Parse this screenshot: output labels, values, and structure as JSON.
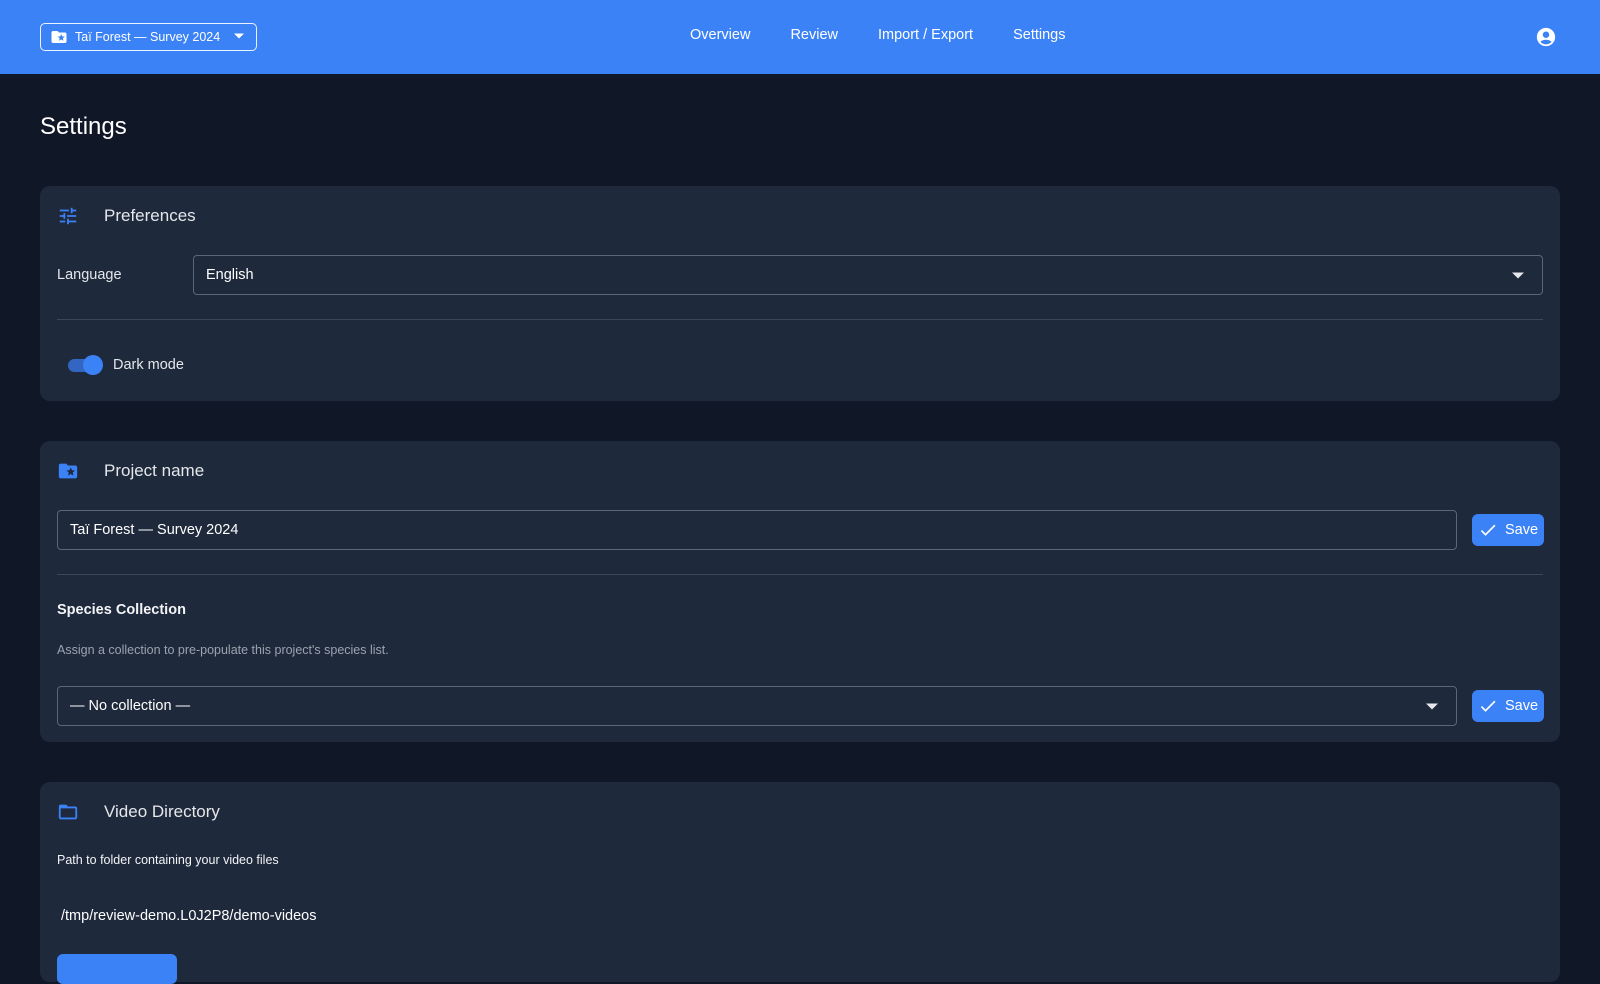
{
  "header": {
    "project_selector": "Taï Forest — Survey 2024",
    "nav": [
      "Overview",
      "Review",
      "Import / Export",
      "Settings"
    ]
  },
  "page": {
    "title": "Settings"
  },
  "preferences": {
    "title": "Preferences",
    "language_label": "Language",
    "language_value": "English",
    "dark_mode_label": "Dark mode",
    "dark_mode_on": true
  },
  "project": {
    "title": "Project name",
    "name_value": "Taï Forest — Survey 2024",
    "save_label": "Save",
    "species_title": "Species Collection",
    "species_help": "Assign a collection to pre-populate this project's species list.",
    "collection_value": "— No collection —",
    "collection_save_label": "Save"
  },
  "video": {
    "title": "Video Directory",
    "help": "Path to folder containing your video files",
    "path": "/tmp/review-demo.L0J2P8/demo-videos"
  },
  "colors": {
    "accent": "#3b82f6",
    "background": "#101828",
    "card": "#1e293b"
  }
}
